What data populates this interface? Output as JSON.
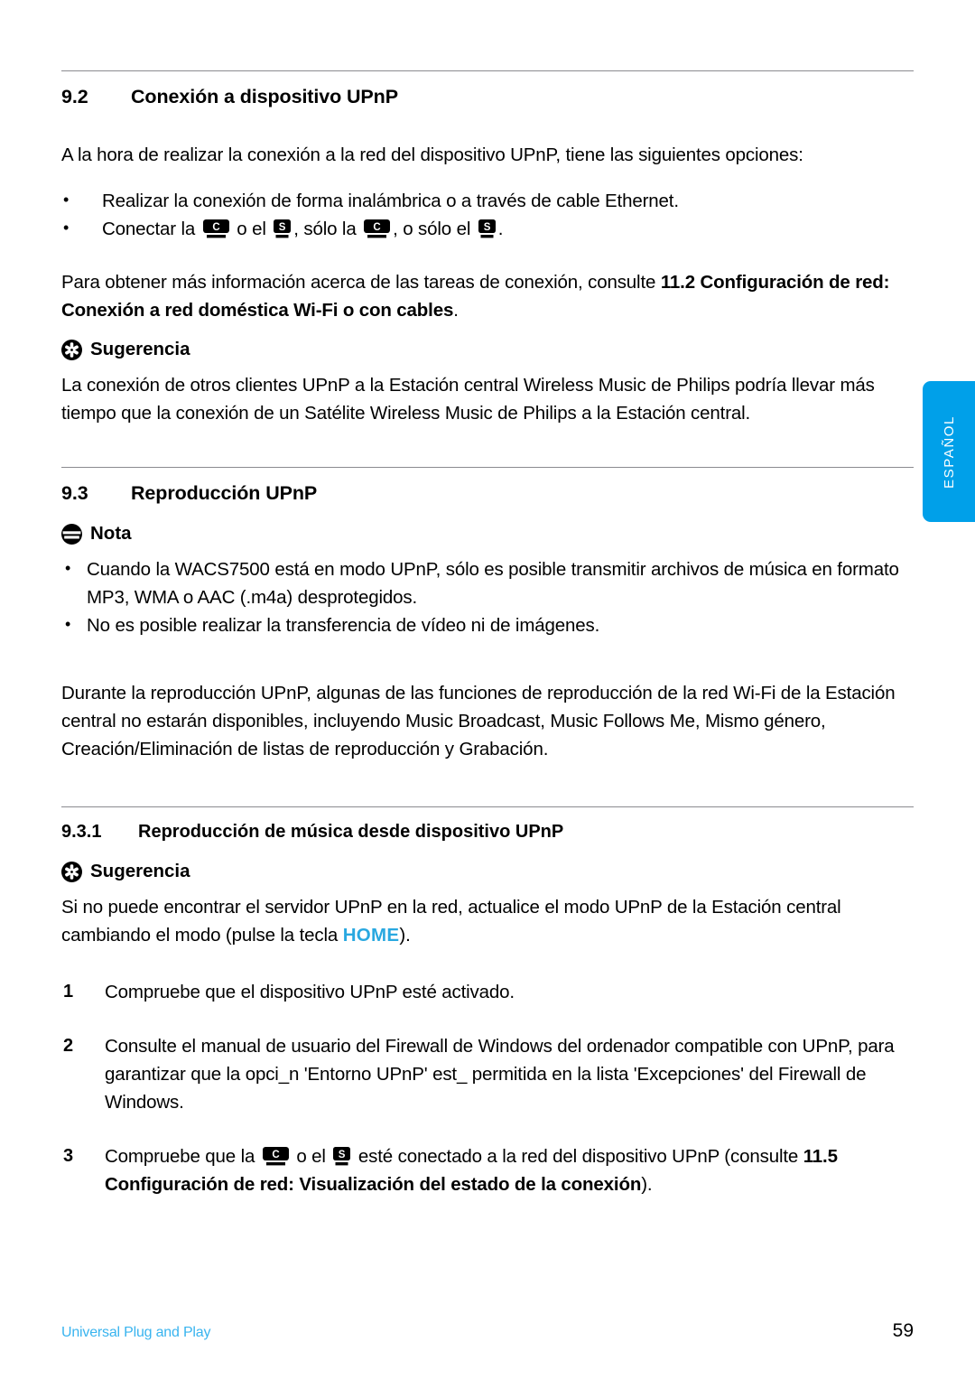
{
  "page": {
    "language_tab": "ESPAÑOL",
    "footer_label": "Universal Plug and Play",
    "page_number": "59",
    "accent_blue": "#00a0e9",
    "key_blue": "#29a8e0",
    "footer_blue": "#39b4ef",
    "rule_color": "#8b8b90"
  },
  "section_92": {
    "number": "9.2",
    "title": "Conexión a dispositivo UPnP",
    "intro": "A la hora de realizar la conexión a la red del dispositivo UPnP, tiene las siguientes opciones:",
    "bullets": {
      "first": "Realizar la conexión de forma inalámbrica o a través de cable Ethernet.",
      "second": {
        "part1": "Conectar la",
        "part2": "o el",
        "part3": ", sólo la",
        "part4": ", o sólo el",
        "part5": "."
      }
    },
    "reference": {
      "lead": "Para obtener más información acerca de las tareas de conexión, consulte ",
      "bold": "11.2 Configuración de red: Conexión a red doméstica Wi-Fi o con cables",
      "tail": "."
    },
    "tip": {
      "icon": "tip-asterisk-icon",
      "heading": "Sugerencia",
      "body": "La conexión de otros clientes UPnP a la Estación central Wireless Music de Philips podría llevar más tiempo que la conexión de un Satélite Wireless Music de Philips a la Estación central."
    }
  },
  "section_93": {
    "number": "9.3",
    "title": "Reproducción UPnP",
    "note": {
      "icon": "note-lines-icon",
      "heading": "Nota",
      "bullets": [
        "Cuando la WACS7500 está en modo UPnP, sólo es posible transmitir archivos de música en formato MP3, WMA o AAC (.m4a) desprotegidos.",
        "No es posible realizar la transferencia de vídeo ni de imágenes."
      ]
    },
    "body": "Durante la reproducción UPnP, algunas de las funciones de reproducción de la red Wi-Fi de la Estación central no estarán disponibles, incluyendo Music Broadcast, Music Follows Me, Mismo género, Creación/Eliminación de listas de reproducción y Grabación."
  },
  "section_931": {
    "number": "9.3.1",
    "title": "Reproducción de música desde dispositivo UPnP",
    "tip": {
      "icon": "tip-asterisk-icon",
      "heading": "Sugerencia",
      "body_lead": "Si no puede encontrar el servidor UPnP en la red, actualice el modo UPnP de la Estación central cambiando el modo (pulse la tecla ",
      "body_key": "HOME",
      "body_tail": ")."
    },
    "steps": [
      {
        "num": "1",
        "text": "Compruebe que el dispositivo UPnP esté activado."
      },
      {
        "num": "2",
        "text": "Consulte el manual de usuario del Firewall de Windows del ordenador compatible con UPnP, para garantizar que la opci_n 'Entorno UPnP' est_ permitida en la lista 'Excepciones' del Firewall de Windows."
      },
      {
        "num": "3",
        "part1": "Compruebe que la",
        "part2": "o el",
        "part3": "esté conectado a la red del dispositivo UPnP (consulte ",
        "bold": "11.5 Configuración de red: Visualización del estado de la conexión",
        "tail": ")."
      }
    ]
  },
  "icons": {
    "center_device": "center-device-c-icon",
    "station_device": "station-device-s-icon",
    "center_letter": "C",
    "station_letter": "S"
  }
}
